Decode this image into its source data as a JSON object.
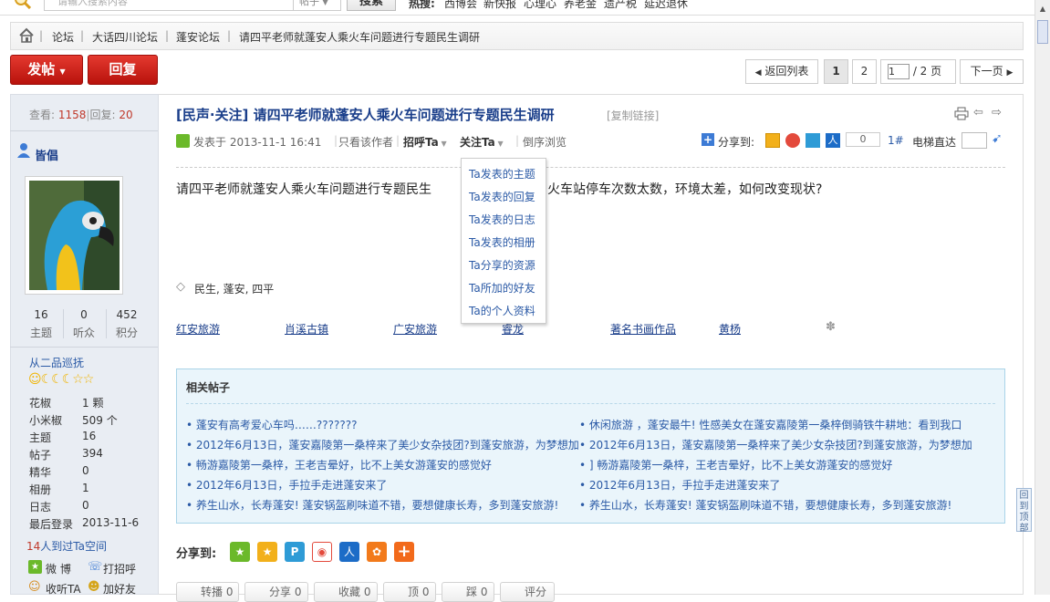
{
  "topbar": {
    "search_placeholder": "请输入搜索内容",
    "search_type": "帖子",
    "search_button": "搜索",
    "hot_label": "热搜:",
    "hot_items": [
      "西博会",
      "新快报",
      "心理心",
      "养老金",
      "遗产税",
      "延迟退休"
    ]
  },
  "breadcrumb": [
    "论坛",
    "大话四川论坛",
    "蓬安论坛",
    "请四平老师就蓬安人乘火车问题进行专题民生调研"
  ],
  "actions": {
    "post_label": "发帖",
    "reply_label": "回复"
  },
  "pagination": {
    "back_label": "返回列表",
    "page1": "1",
    "page2": "2",
    "current_input": "1",
    "total_label": "/ 2 页",
    "next_label": "下一页"
  },
  "thread_stats": {
    "views_label": "查看:",
    "views": "1158",
    "sep": "|",
    "replies_label": "回复:",
    "replies": "20"
  },
  "author": {
    "name": "皆倡",
    "stats": [
      {
        "num": "16",
        "label": "主题"
      },
      {
        "num": "0",
        "label": "听众"
      },
      {
        "num": "452",
        "label": "积分"
      }
    ],
    "rank": "从二品巡抚",
    "info": [
      {
        "label": "花椒",
        "value": "1 颗"
      },
      {
        "label": "小米椒",
        "value": "509 个"
      },
      {
        "label": "主题",
        "value": "16"
      },
      {
        "label": "帖子",
        "value": "394"
      },
      {
        "label": "精华",
        "value": "0"
      },
      {
        "label": "相册",
        "value": "1"
      },
      {
        "label": "日志",
        "value": "0"
      },
      {
        "label": "最后登录",
        "value": "2013-11-6"
      }
    ],
    "visitors_count": "14",
    "visitors_text": "人到过Ta空间",
    "weibo_label": "微 博",
    "greet_label": "打招呼",
    "follow_label": "收听TA",
    "friend_label": "加好友"
  },
  "post": {
    "title": "[民声·关注] 请四平老师就蓬安人乘火车问题进行专题民生调研",
    "copy_link": "[复制链接]",
    "posted_prefix": "发表于",
    "posted_at": "2013-11-1 16:41",
    "author_only": "只看该作者",
    "greet": "招呼Ta",
    "follow": "关注Ta",
    "reverse": "倒序浏览",
    "share_label": "分享到:",
    "share_count": "0",
    "floor": "1#",
    "elevator": "电梯直达",
    "body_left": "请四平老师就蓬安人乘火车问题进行专题民生",
    "body_right": "火车站停车次数太数，环境太差，如何改变现状?",
    "tags": "民生, 蓬安, 四平",
    "links": [
      "红安旅游",
      "肖溪古镇",
      "广安旅游",
      "睿龙",
      "著名书画作品",
      "黄杨"
    ]
  },
  "dropdown": [
    "Ta发表的主题",
    "Ta发表的回复",
    "Ta发表的日志",
    "Ta发表的相册",
    "Ta分享的资源",
    "Ta所加的好友",
    "Ta的个人资料"
  ],
  "related": {
    "title": "相关帖子",
    "left": [
      "• 蓬安有高考爱心车吗……???????",
      "• 2012年6月13日，蓬安嘉陵第一桑梓来了美少女杂技团?到蓬安旅游，为梦想加",
      "• 畅游嘉陵第一桑梓，王老吉晕好，比不上美女游蓬安的感觉好",
      "• 2012年6月13日，手拉手走进蓬安来了",
      "• 养生山水，长寿蓬安! 蓬安锅盔刷味道不错，要想健康长寿，多到蓬安旅游!"
    ],
    "right": [
      "• 休闲旅游 ，蓬安最牛! 性感美女在蓬安嘉陵第一桑梓倒骑铁牛耕地：看到我口",
      "• 2012年6月13日，蓬安嘉陵第一桑梓来了美少女杂技团?到蓬安旅游，为梦想加",
      "• ] 畅游嘉陵第一桑梓，王老吉晕好，比不上美女游蓬安的感觉好",
      "• 2012年6月13日，手拉手走进蓬安来了",
      "• 养生山水，长寿蓬安! 蓬安锅盔刷味道不错，要想健康长寿，多到蓬安旅游!"
    ]
  },
  "share_bottom_label": "分享到:",
  "bottom_actions": [
    "转播 0",
    "分享 0",
    "收藏 0",
    "顶 0",
    "踩 0",
    "评分"
  ],
  "back_top": "回到顶部"
}
